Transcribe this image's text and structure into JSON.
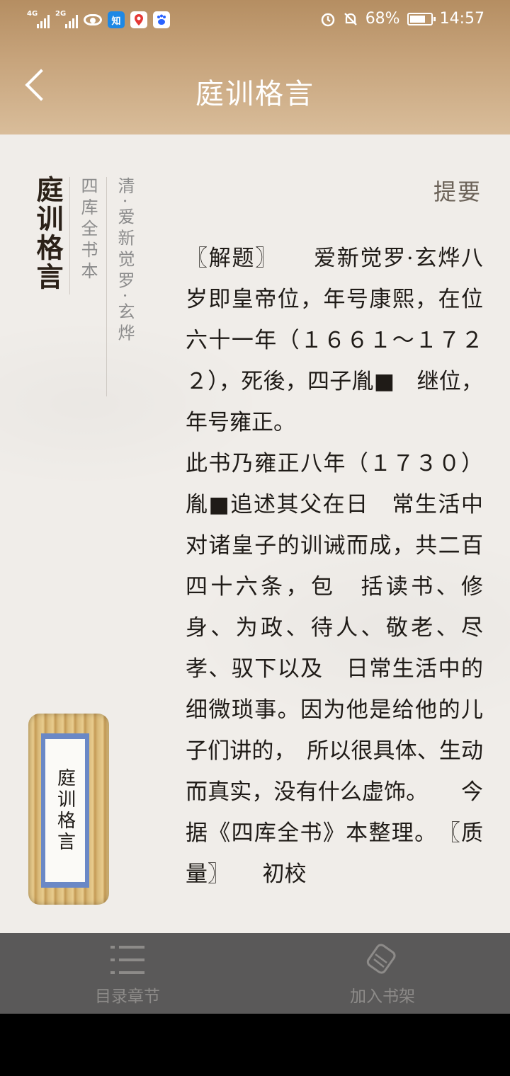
{
  "status_bar": {
    "sim1": "4G",
    "sim2": "2G",
    "app_icon_1": "知",
    "battery": "68%",
    "time": "14:57"
  },
  "header": {
    "title": "庭训格言"
  },
  "book": {
    "title": "庭训格言",
    "edition": "四库全书本",
    "author": "清·爱新觉罗·玄烨",
    "section_label": "提要",
    "scroll_label": "庭训格言",
    "paragraphs": [
      "〖解题〗　　爱新觉罗·玄烨八岁即皇帝位，年号康熙，在位　六十一年（１６６１～１７２２），死後，四子胤■　继位，年号雍正。",
      "此书乃雍正八年（１７３０）胤■追述其父在日　常生活中对诸皇子的训诫而成，共二百四十六条，包　括读书、修身、为政、待人、敬老、尽孝、驭下以及　日常生活中的细微琐事。因为他是给他的儿子们讲的，　所以很具体、生动而真实，没有什么虚饰。　　今据《四库全书》本整理。　〖质量〗　　初校"
    ]
  },
  "bottom_nav": {
    "toc_label": "目录章节",
    "shelf_label": "加入书架"
  },
  "colors": {
    "header_gradient_top": "#b58e62",
    "header_gradient_bottom": "#d9bd9a",
    "paper_bg": "#f0ede9",
    "bottom_bar": "#5a5959",
    "scroll_band": "#6a88c6"
  }
}
